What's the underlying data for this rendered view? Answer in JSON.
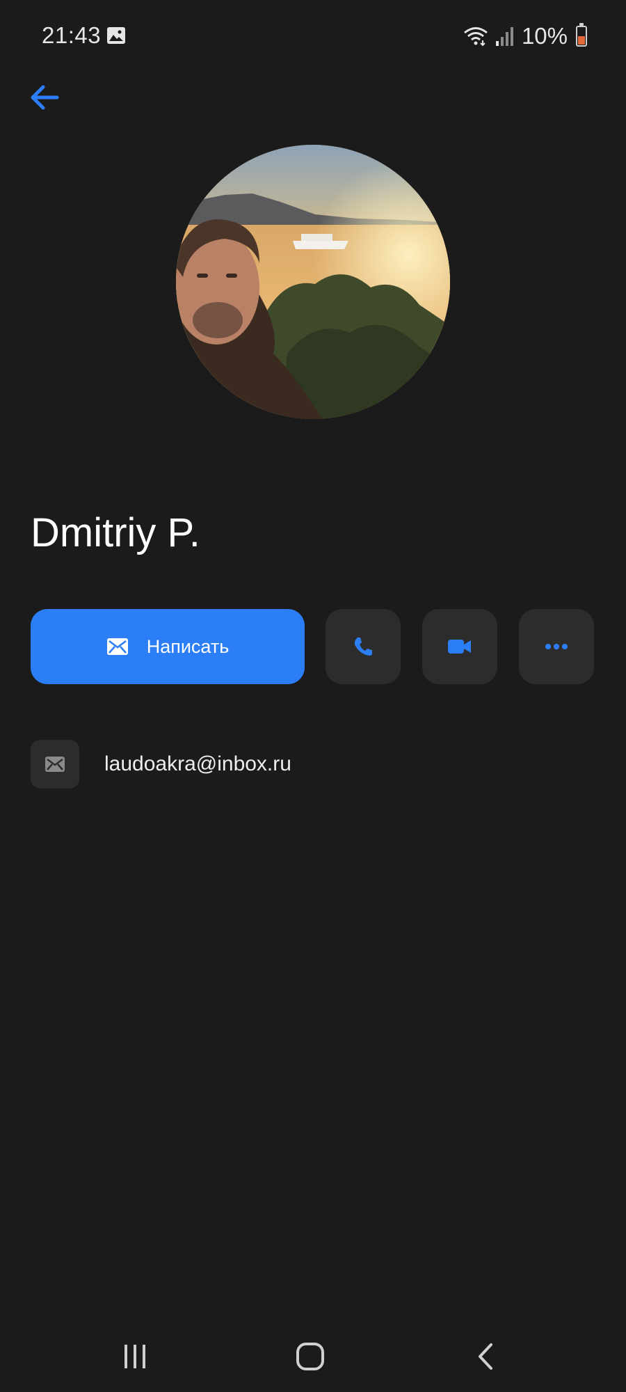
{
  "status_bar": {
    "time": "21:43",
    "battery_text": "10%",
    "icons": [
      "gallery-icon",
      "wifi-icon",
      "signal-icon",
      "battery-icon"
    ]
  },
  "header": {
    "back_icon": "arrow-left-icon"
  },
  "profile": {
    "name": "Dmitriy P."
  },
  "actions": {
    "write_label": "Написать",
    "write_icon": "envelope-icon",
    "call_icon": "phone-icon",
    "video_icon": "video-camera-icon",
    "more_icon": "more-dots-icon"
  },
  "details": {
    "email": "laudoakra@inbox.ru",
    "email_icon": "envelope-icon"
  },
  "nav": {
    "icons": [
      "recent-apps-icon",
      "home-icon",
      "back-icon"
    ]
  },
  "colors": {
    "background": "#1b1b1b",
    "accent": "#2b7ef5",
    "tile": "#2c2c2c"
  }
}
